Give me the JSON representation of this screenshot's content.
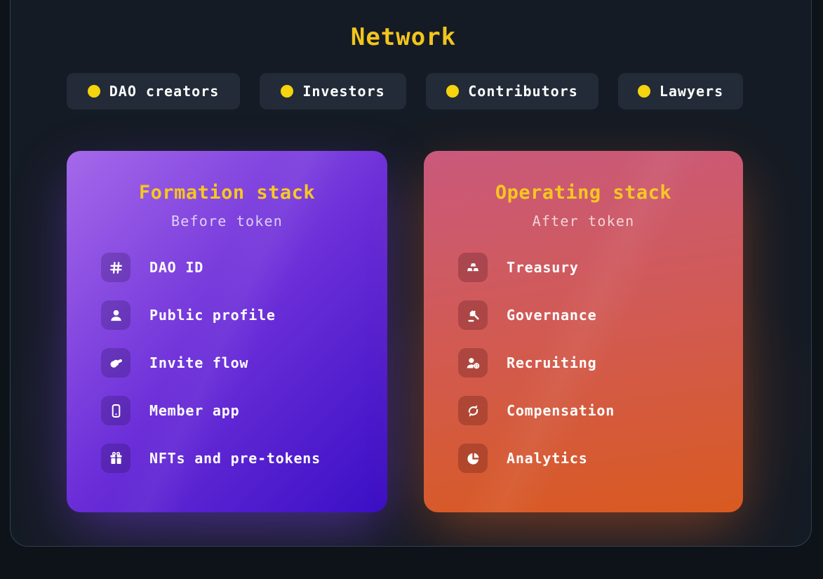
{
  "page": {
    "title": "Network"
  },
  "colors": {
    "accent_yellow": "#f2c51d",
    "card_title_yellow": "#f7c71f",
    "pill_background": "#222b37",
    "panel_background": "#151b24",
    "page_background": "#0e1319",
    "formation_gradient_start": "#a569ea",
    "formation_gradient_end": "#3a0fc5",
    "operating_gradient_start": "#c9597c",
    "operating_gradient_end": "#d95a20"
  },
  "audience_pills": [
    {
      "label": "DAO creators",
      "icon": "status-dot-icon"
    },
    {
      "label": "Investors",
      "icon": "status-dot-icon"
    },
    {
      "label": "Contributors",
      "icon": "status-dot-icon"
    },
    {
      "label": "Lawyers",
      "icon": "status-dot-icon"
    }
  ],
  "cards": [
    {
      "title": "Formation stack",
      "subtitle": "Before token",
      "items": [
        {
          "icon": "hash-icon",
          "label": "DAO ID"
        },
        {
          "icon": "person-icon",
          "label": "Public profile"
        },
        {
          "icon": "handshake-icon",
          "label": "Invite flow"
        },
        {
          "icon": "smartphone-icon",
          "label": "Member app"
        },
        {
          "icon": "gift-icon",
          "label": "NFTs and pre-tokens"
        }
      ]
    },
    {
      "title": "Operating stack",
      "subtitle": "After token",
      "items": [
        {
          "icon": "gold-bars-icon",
          "label": "Treasury"
        },
        {
          "icon": "gavel-icon",
          "label": "Governance"
        },
        {
          "icon": "person-add-icon",
          "label": "Recruiting"
        },
        {
          "icon": "cycle-arrows-icon",
          "label": "Compensation"
        },
        {
          "icon": "pie-chart-icon",
          "label": "Analytics"
        }
      ]
    }
  ]
}
